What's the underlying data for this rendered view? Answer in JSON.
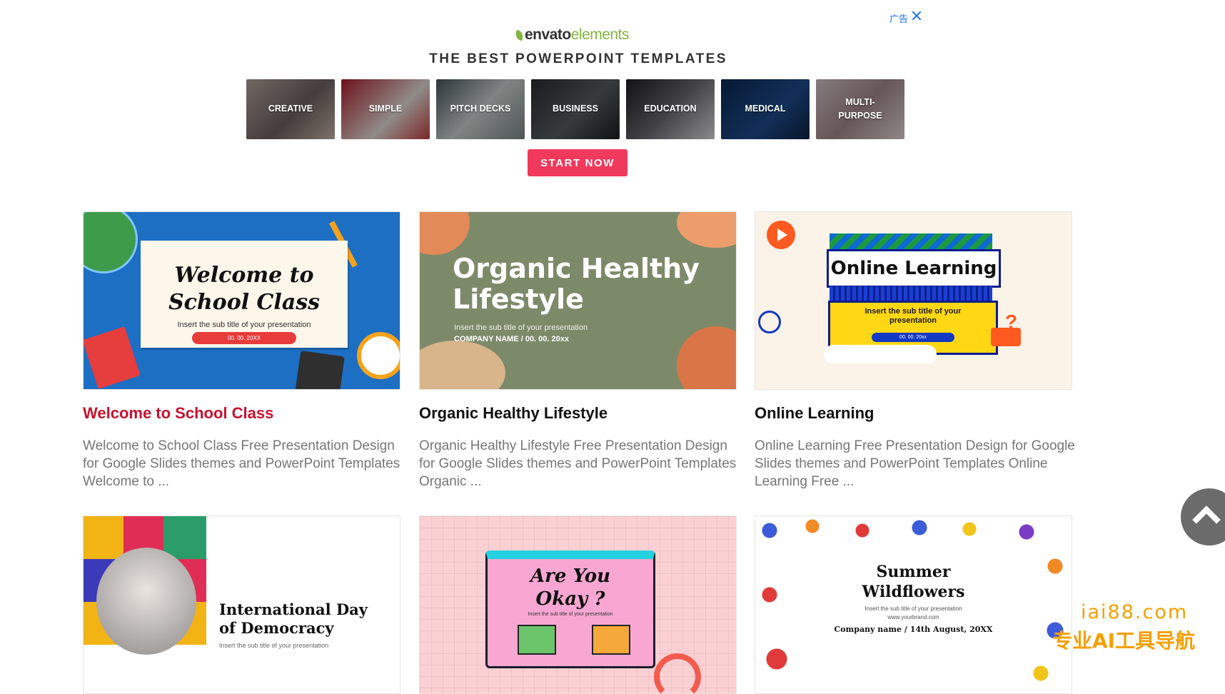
{
  "ad": {
    "label": "广告",
    "logo_part1": "envato",
    "logo_part2": "elements",
    "headline": "THE BEST POWERPOINT TEMPLATES",
    "categories": [
      "CREATIVE",
      "SIMPLE",
      "PITCH DECKS",
      "BUSINESS",
      "EDUCATION",
      "MEDICAL",
      "MULTI-\nPURPOSE"
    ],
    "cta": "START NOW",
    "colors": {
      "cta": "#f0395b",
      "logo_green": "#82b541",
      "ad_blue": "#1a73e8"
    }
  },
  "cards": [
    {
      "title": "Welcome to School Class",
      "description": "Welcome to School Class Free Presentation Design for Google Slides themes and PowerPoint Templates Welcome to ...",
      "thumb": {
        "title": "Welcome to\nSchool Class",
        "subtitle": "Insert the sub title of your presentation",
        "date": "00. 00. 20XX"
      }
    },
    {
      "title": "Organic Healthy Lifestyle",
      "description": "Organic Healthy Lifestyle Free Presentation Design for Google Slides themes and PowerPoint Templates Organic ...",
      "thumb": {
        "title": "Organic Healthy\nLifestyle",
        "subtitle": "Insert the sub title of your presentation",
        "company": "COMPANY NAME / 00. 00. 20xx"
      }
    },
    {
      "title": "Online Learning",
      "description": "Online Learning Free Presentation Design for Google Slides themes and PowerPoint Templates Online Learning Free ...",
      "thumb": {
        "title": "Online Learning",
        "subtitle": "Insert the sub title of your\npresentation",
        "date": "00. 00. 20xx"
      }
    },
    {
      "title": "International Day of Democracy",
      "thumb": {
        "title": "International Day\nof Democracy",
        "subtitle": "Insert the sub title of your presentation"
      }
    },
    {
      "title": "Are You Okay?",
      "thumb": {
        "title": "Are You\nOkay ?",
        "subtitle": "Insert the sub title of your presentation"
      }
    },
    {
      "title": "Summer Wildflowers",
      "thumb": {
        "title": "Summer\nWildflowers",
        "subtitle": "Insert the sub title of your presentation\nwww.yourbrand.com",
        "company": "Company name  /  14th August, 20XX"
      }
    }
  ],
  "watermark": {
    "line1": "iai88.com",
    "line2": "专业AI工具导航"
  },
  "colors": {
    "active_title": "#c8102e",
    "description": "#767676"
  }
}
